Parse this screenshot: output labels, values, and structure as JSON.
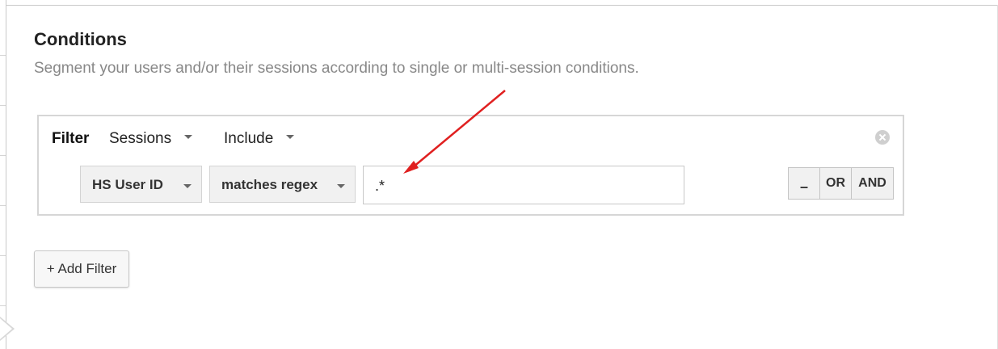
{
  "section": {
    "title": "Conditions",
    "subtitle": "Segment your users and/or their sessions according to single or multi-session conditions."
  },
  "filter": {
    "label": "Filter",
    "scope_selected": "Sessions",
    "mode_selected": "Include",
    "condition": {
      "dimension": "HS User ID",
      "operator": "matches regex",
      "value": ".*"
    },
    "buttons": {
      "remove": "–",
      "or": "OR",
      "and": "AND"
    }
  },
  "add_filter_label": "+ Add Filter",
  "annotation": {
    "arrow_color": "#e02020"
  }
}
